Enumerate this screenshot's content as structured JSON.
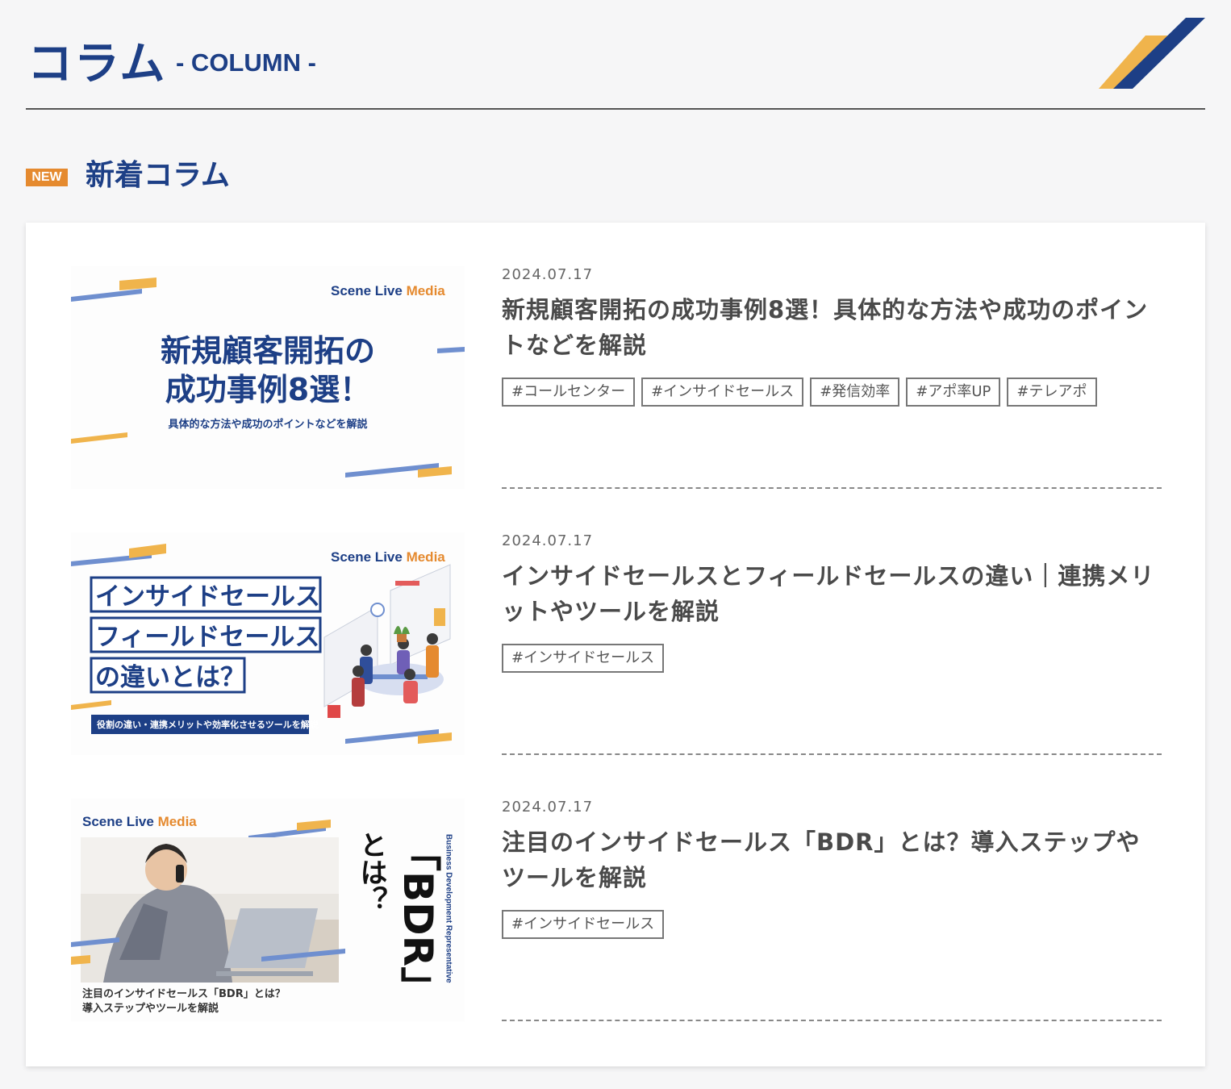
{
  "header": {
    "title": "コラム",
    "subtitle": "- COLUMN -"
  },
  "section": {
    "badge": "NEW",
    "title": "新着コラム"
  },
  "colors": {
    "brand_blue": "#1d3f86",
    "accent_orange": "#e58a2f",
    "accent_yellow": "#f0b44c",
    "light_blue": "#6f8fcf"
  },
  "articles": [
    {
      "date": "2024.07.17",
      "title": "新規顧客開拓の成功事例8選！具体的な方法や成功のポイントなどを解説",
      "tags": [
        "#コールセンター",
        "#インサイドセールス",
        "#発信効率",
        "#アポ率UP",
        "#テレアポ"
      ],
      "thumb": {
        "brand_prefix": "Scene Live ",
        "brand_suffix": "Media",
        "line1": "新規顧客開拓の",
        "line2": "成功事例8選！",
        "caption": "具体的な方法や成功のポイントなどを解説"
      }
    },
    {
      "date": "2024.07.17",
      "title": "インサイドセールスとフィールドセールスの違い｜連携メリットやツールを解説",
      "tags": [
        "#インサイドセールス"
      ],
      "thumb": {
        "brand_prefix": "Scene Live ",
        "brand_suffix": "Media",
        "box1": "インサイドセールス",
        "box2": "フィールドセールス",
        "box3": "の違いとは？",
        "caption": "役割の違い・連携メリットや効率化させるツールを解説"
      }
    },
    {
      "date": "2024.07.17",
      "title": "注目のインサイドセールス「BDR」とは？導入ステップやツールを解説",
      "tags": [
        "#インサイドセールス"
      ],
      "thumb": {
        "brand_prefix": "Scene Live ",
        "brand_suffix": "Media",
        "vertical_big": "「BDR」",
        "vertical_small": "とは？",
        "vertical_en": "Business Development Representative",
        "caption1": "注目のインサイドセールス「BDR」とは？",
        "caption2": "導入ステップやツールを解説"
      }
    }
  ]
}
